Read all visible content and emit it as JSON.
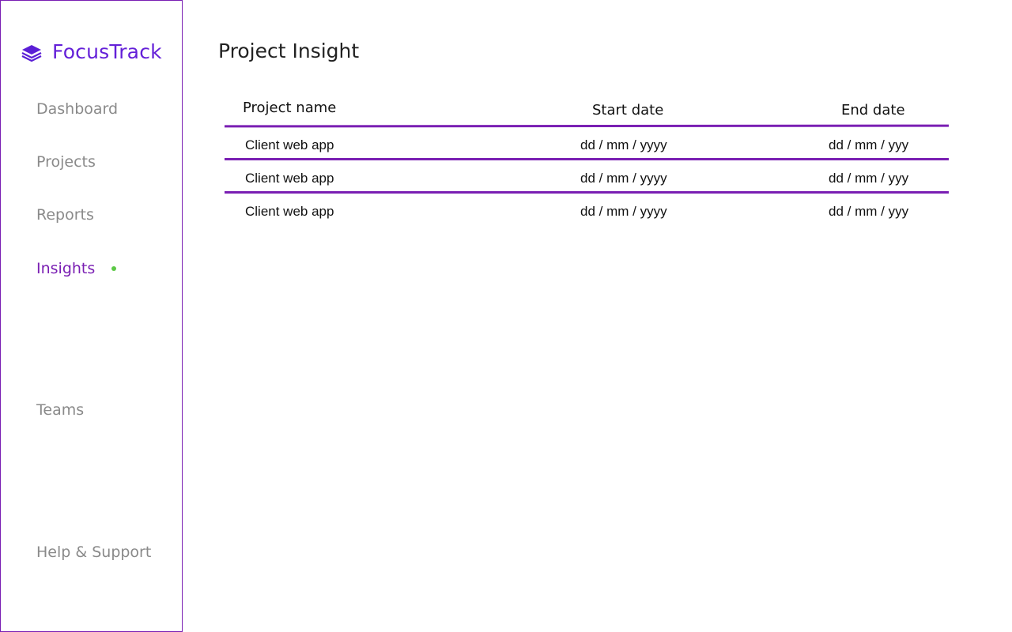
{
  "brand": {
    "name": "FocusTrack",
    "accent": "#6420d8",
    "icon": "layers-icon"
  },
  "sidebar": {
    "border_color": "#7a1fb3",
    "items": [
      {
        "label": "Dashboard",
        "active": false
      },
      {
        "label": "Projects",
        "active": false
      },
      {
        "label": "Reports",
        "active": false
      },
      {
        "label": "Insights",
        "active": true
      },
      {
        "label": "Teams",
        "active": false
      },
      {
        "label": "Help & Support",
        "active": false
      }
    ],
    "active_color": "#7a1fb3",
    "inactive_color": "#8a8a8a",
    "active_dot_color": "#5cc846"
  },
  "main": {
    "title": "Project Insight",
    "table": {
      "rule_color": "#7a1fb3",
      "columns": [
        "Project name",
        "Start date",
        "End date"
      ],
      "rows": [
        [
          "Client web app",
          "dd / mm / yyyy",
          "dd / mm / yyy"
        ],
        [
          "Client web app",
          "dd / mm / yyyy",
          "dd / mm / yyy"
        ],
        [
          "Client web app",
          "dd / mm / yyyy",
          "dd / mm / yyy"
        ]
      ]
    }
  }
}
